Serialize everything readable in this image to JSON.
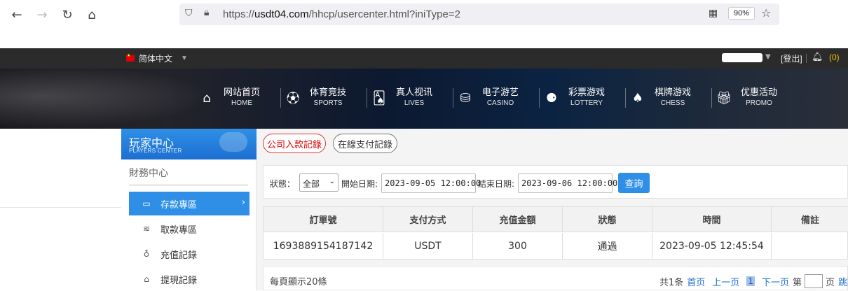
{
  "browser": {
    "url_prefix": "https://",
    "url_domain": "usdt04.com",
    "url_path": "/hhcp/usercenter.html?iniType=2",
    "zoom": "90%"
  },
  "topbar": {
    "language": "简体中文",
    "logout": "[登出]",
    "notification_count": "(0)"
  },
  "nav": [
    {
      "cn": "网站首页",
      "en": "HOME",
      "icon": "home-icon"
    },
    {
      "cn": "体育竞技",
      "en": "SPORTS",
      "icon": "ball-icon"
    },
    {
      "cn": "真人视讯",
      "en": "LIVES",
      "icon": "cards-icon"
    },
    {
      "cn": "电子游艺",
      "en": "CASINO",
      "icon": "chips-icon"
    },
    {
      "cn": "彩票游戏",
      "en": "LOTTERY",
      "icon": "lottery-icon"
    },
    {
      "cn": "棋牌游戏",
      "en": "CHESS",
      "icon": "spade-icon"
    },
    {
      "cn": "优惠活动",
      "en": "PROMO",
      "icon": "gift-icon"
    }
  ],
  "sidebar": {
    "title_cn": "玩家中心",
    "title_en": "PLAYERS CENTER",
    "section": "財務中心",
    "items": [
      {
        "label": "存款專區",
        "icon": "card-icon",
        "active": true
      },
      {
        "label": "取款專區",
        "icon": "cash-icon",
        "active": false
      },
      {
        "label": "充值記錄",
        "icon": "moneybag-icon",
        "active": false
      },
      {
        "label": "提現記錄",
        "icon": "withdraw-icon",
        "active": false
      }
    ]
  },
  "tabs": {
    "company_deposit": "公司入款記錄",
    "online_payment": "在線支付記錄"
  },
  "filter": {
    "status_label": "狀態：",
    "status_value": "全部",
    "start_label": "開始日期:",
    "start_value": "2023-09-05 12:00:00",
    "end_label": "結束日期:",
    "end_value": "2023-09-06 12:00:00",
    "query": "查詢"
  },
  "table": {
    "headers": [
      "訂單號",
      "支付方式",
      "充值金額",
      "狀態",
      "時間",
      "備註"
    ],
    "rows": [
      [
        "1693889154187142",
        "USDT",
        "300",
        "通過",
        "2023-09-05 12:45:54",
        ""
      ]
    ]
  },
  "pager": {
    "per_page": "每頁顯示20條",
    "total": "共1条",
    "first": "首页",
    "prev": "上一页",
    "current": "1",
    "next": "下一页",
    "goto_prefix": "第",
    "goto_suffix": "页",
    "jump": "跳转"
  }
}
